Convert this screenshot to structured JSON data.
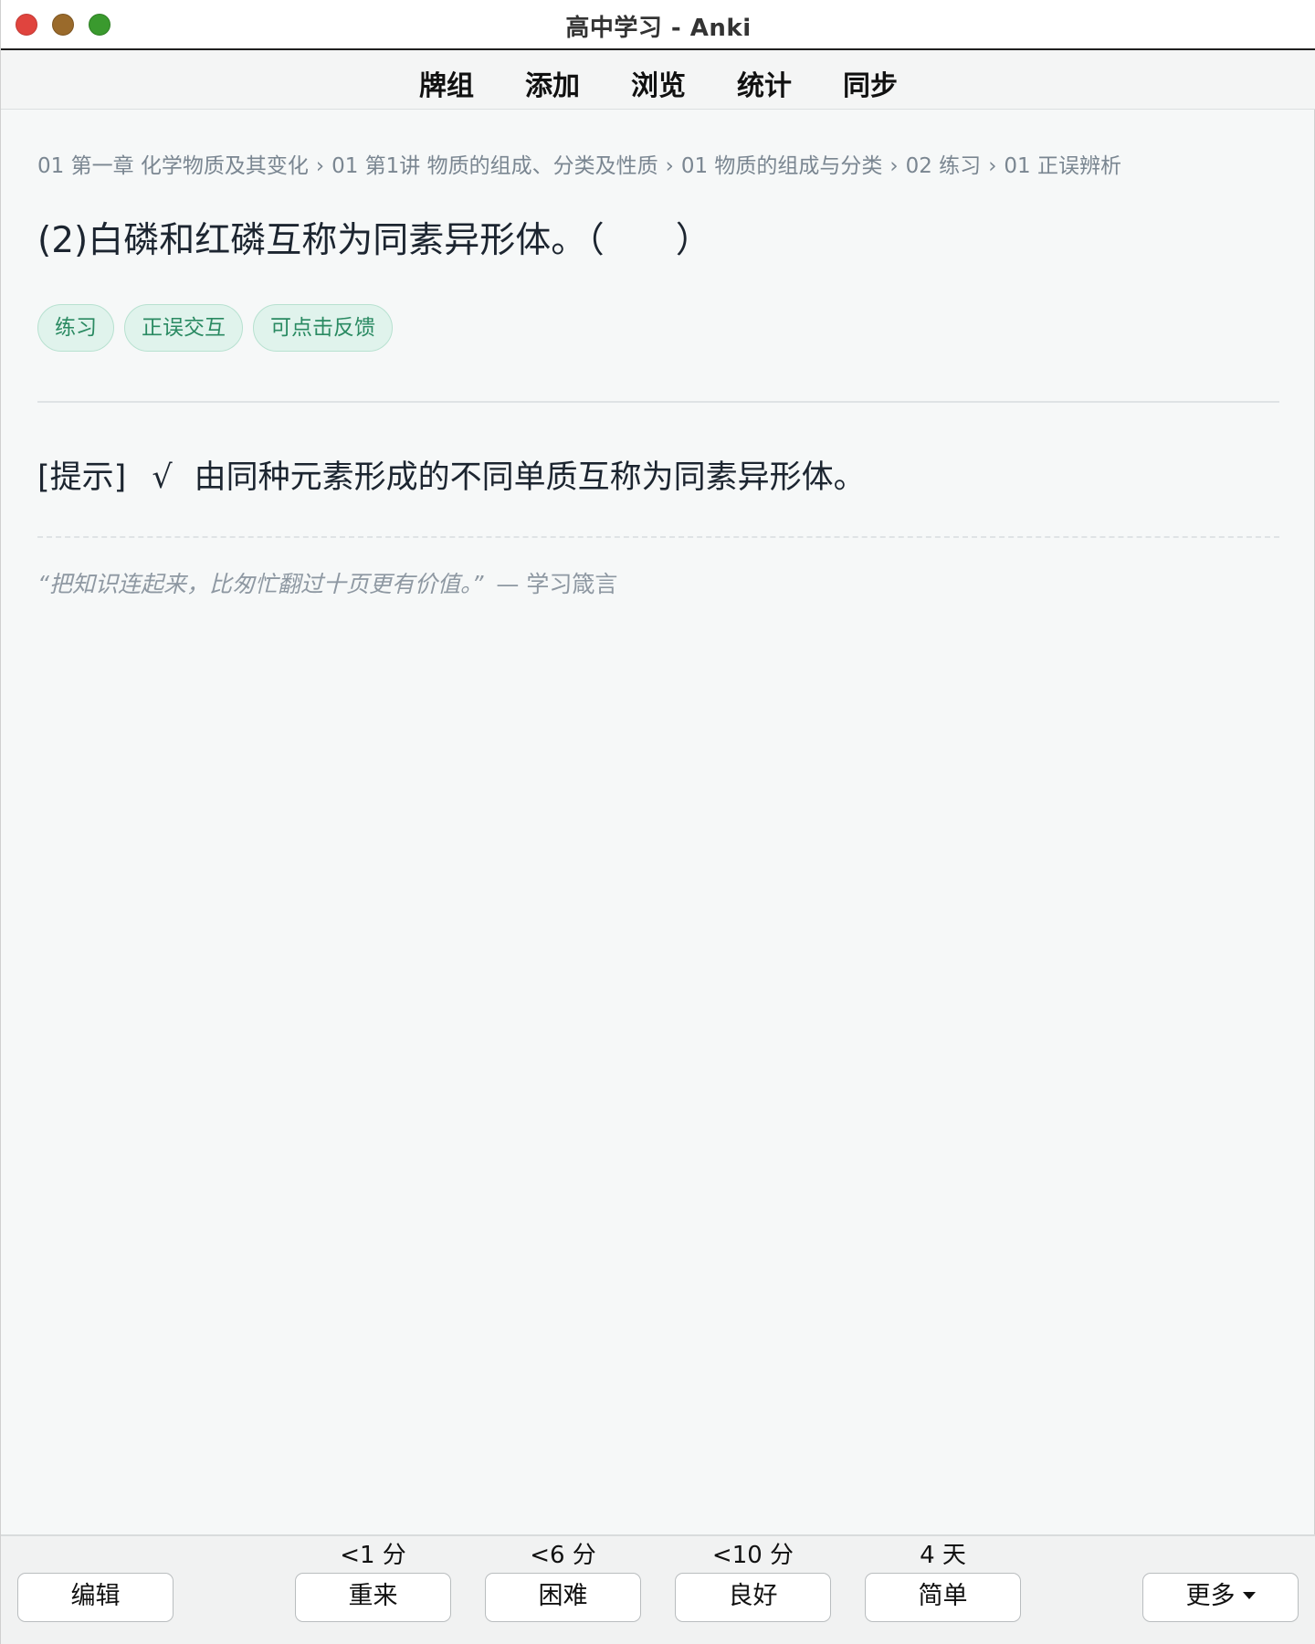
{
  "window": {
    "title": "高中学习 - Anki"
  },
  "toolbar": {
    "items": [
      "牌组",
      "添加",
      "浏览",
      "统计",
      "同步"
    ]
  },
  "breadcrumb": {
    "items": [
      "01 第一章 化学物质及其变化",
      "01 第1讲 物质的组成、分类及性质",
      "01 物质的组成与分类",
      "02 练习",
      "01 正误辨析"
    ],
    "separator": "›"
  },
  "card": {
    "question": "(2)白磷和红磷互称为同素异形体。（　　）",
    "tags": [
      "练习",
      "正误交互",
      "可点击反馈"
    ],
    "hint_label": "[提示]",
    "hint_mark": "√",
    "hint_text": "由同种元素形成的不同单质互称为同素异形体。",
    "quote_text": "“把知识连起来，比匆忙翻过十页更有价值。”",
    "quote_source": "— 学习箴言"
  },
  "bottombar": {
    "edit_label": "编辑",
    "more_label": "更多",
    "answers": [
      {
        "interval": "<1 分",
        "label": "重来"
      },
      {
        "interval": "<6 分",
        "label": "困难"
      },
      {
        "interval": "<10 分",
        "label": "良好"
      },
      {
        "interval": "4 天",
        "label": "简单"
      }
    ]
  },
  "colors": {
    "traffic_close": "#e0443e",
    "traffic_minimize": "#9a6a2b",
    "traffic_maximize": "#3a9a2e",
    "tag_background": "#e0f3ec",
    "tag_text": "#2a8a62",
    "breadcrumb_text": "#7a8691"
  }
}
